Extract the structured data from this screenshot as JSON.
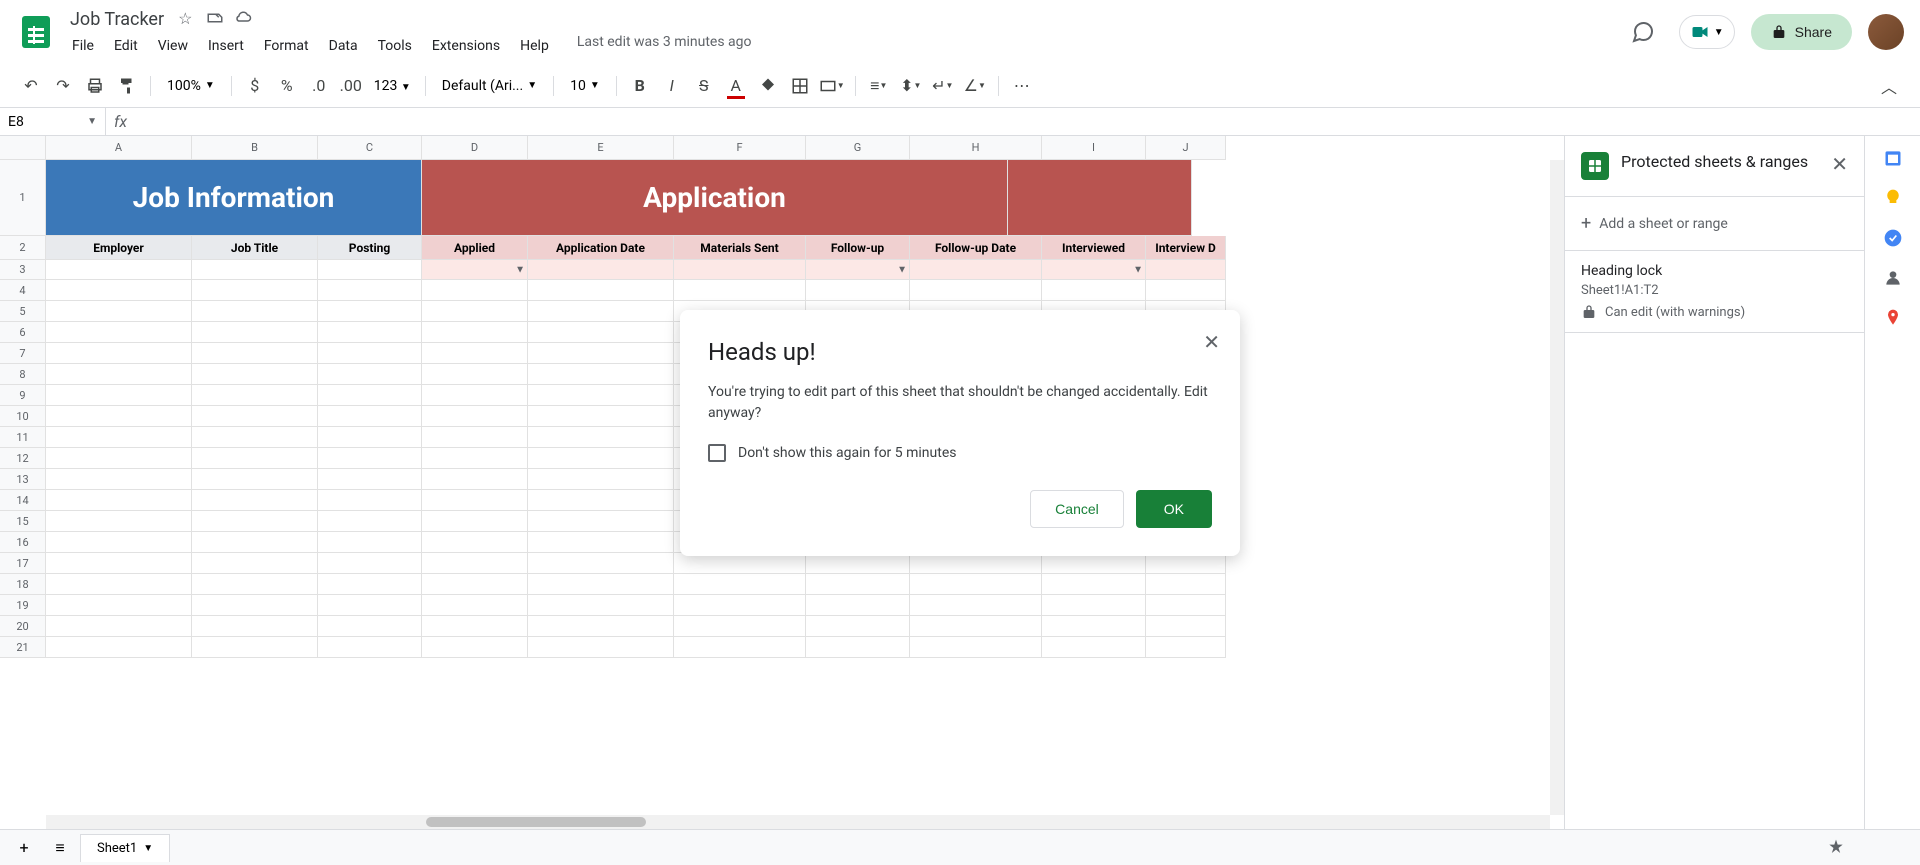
{
  "doc": {
    "title": "Job Tracker",
    "last_edit": "Last edit was 3 minutes ago"
  },
  "menu": [
    "File",
    "Edit",
    "View",
    "Insert",
    "Format",
    "Data",
    "Tools",
    "Extensions",
    "Help"
  ],
  "share_label": "Share",
  "toolbar": {
    "zoom": "100%",
    "font": "Default (Ari...",
    "font_size": "10",
    "format_123": "123"
  },
  "formula_bar": {
    "cell": "E8",
    "value": ""
  },
  "columns": [
    "A",
    "B",
    "C",
    "D",
    "E",
    "F",
    "G",
    "H",
    "I",
    "J"
  ],
  "row1": {
    "section1": "Job Information",
    "section2": "Application"
  },
  "row2": [
    "Employer",
    "Job Title",
    "Posting",
    "Applied",
    "Application Date",
    "Materials Sent",
    "Follow-up",
    "Follow-up Date",
    "Interviewed",
    "Interview D"
  ],
  "side_panel": {
    "title": "Protected sheets & ranges",
    "add_label": "Add a sheet or range",
    "item": {
      "name": "Heading lock",
      "ref": "Sheet1!A1:T2",
      "perm": "Can edit (with warnings)"
    }
  },
  "sheet_tab": "Sheet1",
  "modal": {
    "title": "Heads up!",
    "body": "You're trying to edit part of this sheet that shouldn't be changed accidentally. Edit anyway?",
    "checkbox_label": "Don't show this again for 5 minutes",
    "cancel": "Cancel",
    "ok": "OK"
  }
}
